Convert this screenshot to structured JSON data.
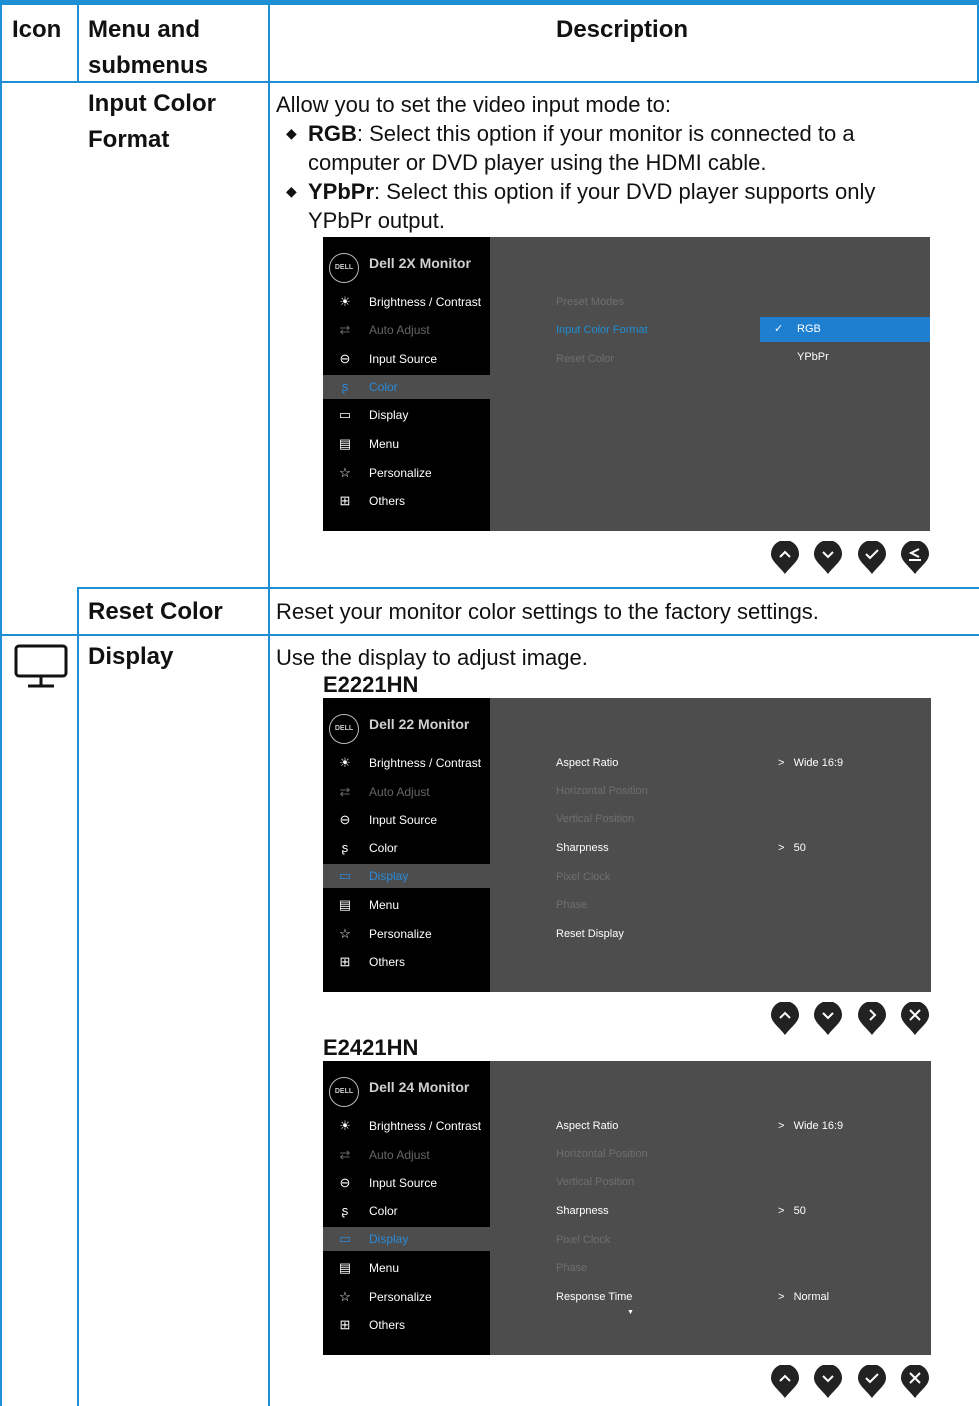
{
  "table": {
    "header": {
      "icon": "Icon",
      "menu_line1": "Menu and",
      "menu_line2": "submenus",
      "description": "Description"
    }
  },
  "input_color_format": {
    "name_line1": "Input Color",
    "name_line2": "Format",
    "intro": "Allow you to set the video input mode to:",
    "bullets": [
      {
        "bold": "RGB",
        "text": ": Select this option if your monitor is connected to a computer or DVD player using the HDMI cable."
      },
      {
        "bold": "YPbPr",
        "text": ": Select this option if your DVD player supports only YPbPr output."
      }
    ],
    "osd": {
      "title": "Dell 2X Monitor",
      "submenu": [
        "Preset Modes",
        "Input Color Format",
        "Reset Color"
      ],
      "options": [
        "RGB",
        "YPbPr"
      ],
      "selected_check": "✓"
    }
  },
  "reset_color": {
    "name": "Reset Color",
    "text": "Reset your monitor color settings to the factory settings."
  },
  "display": {
    "name": "Display",
    "intro": "Use the display to adjust image.",
    "models": [
      {
        "model": "E2221HN",
        "osd_title": "Dell 22 Monitor",
        "rows": [
          {
            "label": "Aspect Ratio",
            "value": "Wide 16:9",
            "enabled": true
          },
          {
            "label": "Horizontal Position",
            "value": "",
            "enabled": false
          },
          {
            "label": "Vertical Position",
            "value": "",
            "enabled": false
          },
          {
            "label": "Sharpness",
            "value": "50",
            "enabled": true
          },
          {
            "label": "Pixel Clock",
            "value": "",
            "enabled": false
          },
          {
            "label": "Phase",
            "value": "",
            "enabled": false
          },
          {
            "label": "Reset Display",
            "value": "",
            "enabled": true
          }
        ]
      },
      {
        "model": "E2421HN",
        "osd_title": "Dell 24 Monitor",
        "rows": [
          {
            "label": "Aspect Ratio",
            "value": "Wide 16:9",
            "enabled": true
          },
          {
            "label": "Horizontal Position",
            "value": "",
            "enabled": false
          },
          {
            "label": "Vertical Position",
            "value": "",
            "enabled": false
          },
          {
            "label": "Sharpness",
            "value": "50",
            "enabled": true
          },
          {
            "label": "Pixel Clock",
            "value": "",
            "enabled": false
          },
          {
            "label": "Phase",
            "value": "",
            "enabled": false
          },
          {
            "label": "Response Time",
            "value": "Normal",
            "enabled": true
          }
        ]
      }
    ]
  },
  "osd_main_menu": [
    "Brightness / Contrast",
    "Auto Adjust",
    "Input Source",
    "Color",
    "Display",
    "Menu",
    "Personalize",
    "Others"
  ],
  "osd_logo": "DELL",
  "value_arrow": ">",
  "colors": {
    "table_line": "#1e8fd5",
    "osd_panel": "#4d4d4d",
    "osd_highlight": "#1e7fd0"
  }
}
